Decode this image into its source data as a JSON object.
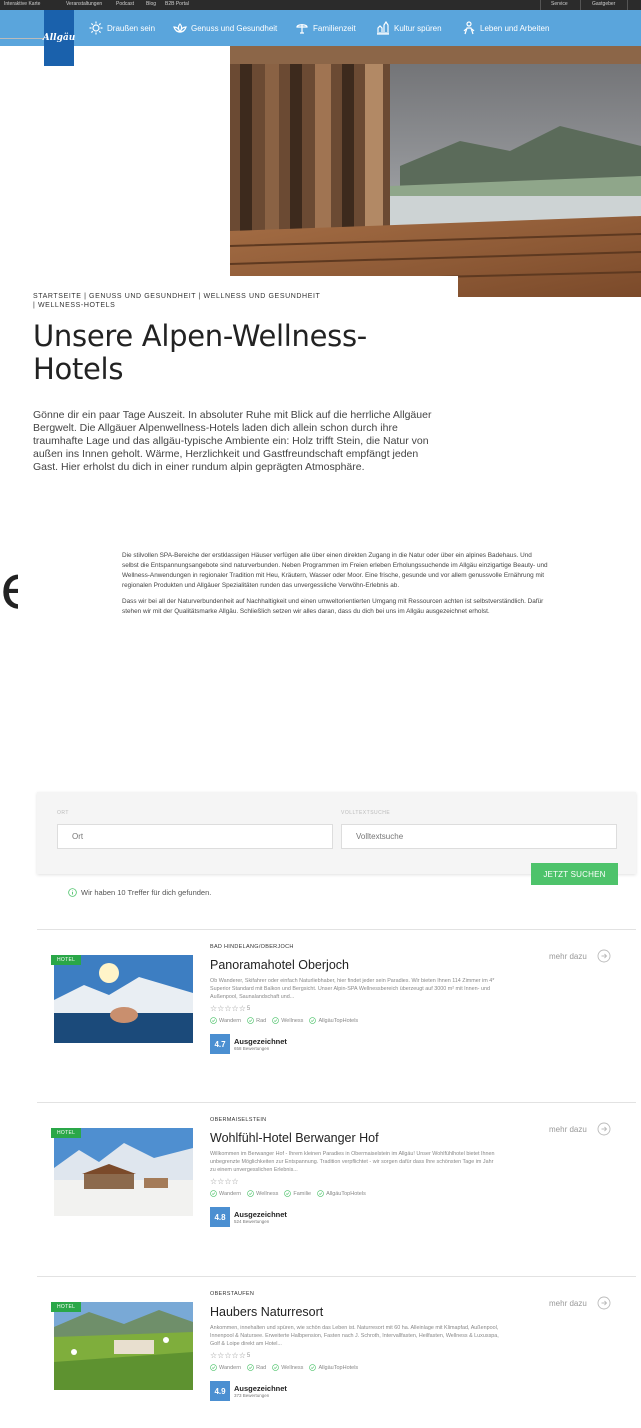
{
  "topbar": {
    "left_links": [
      "Interaktive Karte",
      "Veranstaltungen",
      "Podcast",
      "Blog",
      "B2B Portal"
    ],
    "right_links": [
      "Service",
      "Gastgeber"
    ]
  },
  "brand": {
    "logo_text": "Allgäu"
  },
  "nav": {
    "items": [
      {
        "label": "Draußen sein",
        "icon": "sun-icon"
      },
      {
        "label": "Genuss und Gesundheit",
        "icon": "lotus-icon"
      },
      {
        "label": "Familienzeit",
        "icon": "parasol-icon"
      },
      {
        "label": "Kultur spüren",
        "icon": "castle-icon"
      },
      {
        "label": "Leben und Arbeiten",
        "icon": "person-icon"
      }
    ]
  },
  "breadcrumb": {
    "line1": "STARTSEITE | GENUSS UND GESUNDHEIT | WELLNESS UND GESUNDHEIT",
    "line2": "| WELLNESS-HOTELS"
  },
  "page": {
    "title": "Unsere Alpen-Wellness-Hotels",
    "lead": "Gönne dir ein paar Tage Auszeit. In absoluter Ruhe mit Blick auf die herrliche Allgäuer Bergwelt. Die Allgäuer Alpenwellness-Hotels laden dich allein schon durch ihre traumhafte Lage und das allgäu-typische Ambiente ein: Holz trifft Stein, die Natur von außen ins Innen geholt. Wärme, Herzlichkeit und Gastfreundschaft empfängt jeden Gast. Hier erholst du dich in einer rundum alpin geprägten Atmosphäre.",
    "body_p1": "Die stilvollen SPA-Bereiche der erstklassigen Häuser verfügen alle über einen direkten Zugang in die Natur oder über ein alpines Badehaus. Und selbst die Entspannungsangebote sind naturverbunden. Neben Programmen im Freien erleben Erholungssuchende im Allgäu einzigartige Beauty- und Wellness-Anwendungen in regionaler Tradition mit Heu, Kräutern, Wasser oder Moor. Eine frische, gesunde und vor allem genussvolle Ernährung mit regionalen Produkten und Allgäuer Spezialitäten runden das unvergessliche Verwöhn-Erlebnis ab.",
    "body_p2": "Dass wir bei all der Naturverbundenheit auf Nachhaltigkeit und einen umweltorientierten Umgang mit Ressourcen achten ist selbstverständlich. Dafür stehen wir mit der Qualitätsmarke Allgäu. Schließlich setzen wir alles daran, dass du dich bei uns im Allgäu ausgezeichnet erholst.",
    "edge_glyph": "e"
  },
  "search": {
    "ort_label": "ORT",
    "ort_placeholder": "Ort",
    "volltext_label": "VOLLTEXTSUCHE",
    "volltext_placeholder": "Volltextsuche",
    "button": "JETZT SUCHEN",
    "results_note": "Wir haben 10 Treffer für dich gefunden."
  },
  "results": [
    {
      "badge": "HOTEL",
      "location": "BAD HINDELANG/OBERJOCH",
      "name": "Panoramahotel Oberjoch",
      "desc": "Ob Wanderer, Skifahrer oder einfach Naturliebhaber, hier findet jeder sein Paradies. Wir bieten Ihnen 114 Zimmer im 4* Superior Standard mit Balkon und Bergsicht. Unser Alpin-SPA Wellnessbereich überzeugt auf 3000 m² mit Innen- und Außenpool, Saunalandschaft und...",
      "stars": "☆☆☆☆☆",
      "stars_num": "5",
      "tags": [
        "Wandern",
        "Rad",
        "Wellness",
        "AllgäuTopHotels"
      ],
      "score": "4.7",
      "rating_label": "Ausgezeichnet",
      "rating_count": "658 Bewertungen",
      "more": "mehr dazu"
    },
    {
      "badge": "HOTEL",
      "location": "OBERMAISELSTEIN",
      "name": "Wohlfühl-Hotel Berwanger Hof",
      "desc": "Willkommen im Berwanger Hof - Ihrem kleinen Paradies in Obermaiselstein im Allgäu! Unser Wohlfühlhotel bietet Ihnen unbegrenzte Möglichkeiten zur Entspannung. Tradition verpflichtet - wir sorgen dafür dass Ihre schönsten Tage im Jahr zu einem unvergesslichen Erlebnis...",
      "stars": "☆☆☆☆",
      "stars_num": "",
      "tags": [
        "Wandern",
        "Wellness",
        "Familie",
        "AllgäuTopHotels"
      ],
      "score": "4.8",
      "rating_label": "Ausgezeichnet",
      "rating_count": "524 Bewertungen",
      "more": "mehr dazu"
    },
    {
      "badge": "HOTEL",
      "location": "OBERSTAUFEN",
      "name": "Haubers Naturresort",
      "desc": "Ankommen, innehalten und spüren, wie schön das Leben ist. Naturresort mit 60 ha. Alleinlage mit Klimapfad, Außenpool, Innenpool & Natursee. Erweiterte Halbpension, Fasten nach J. Schroth, Intervallfasten, Heilfasten, Wellness & Luxusspa, Golf & Loipe direkt am Hotel...",
      "stars": "☆☆☆☆☆",
      "stars_num": "5",
      "tags": [
        "Wandern",
        "Rad",
        "Wellness",
        "AllgäuTopHotels"
      ],
      "score": "4.9",
      "rating_label": "Ausgezeichnet",
      "rating_count": "373 Bewertungen",
      "more": "mehr dazu"
    }
  ]
}
